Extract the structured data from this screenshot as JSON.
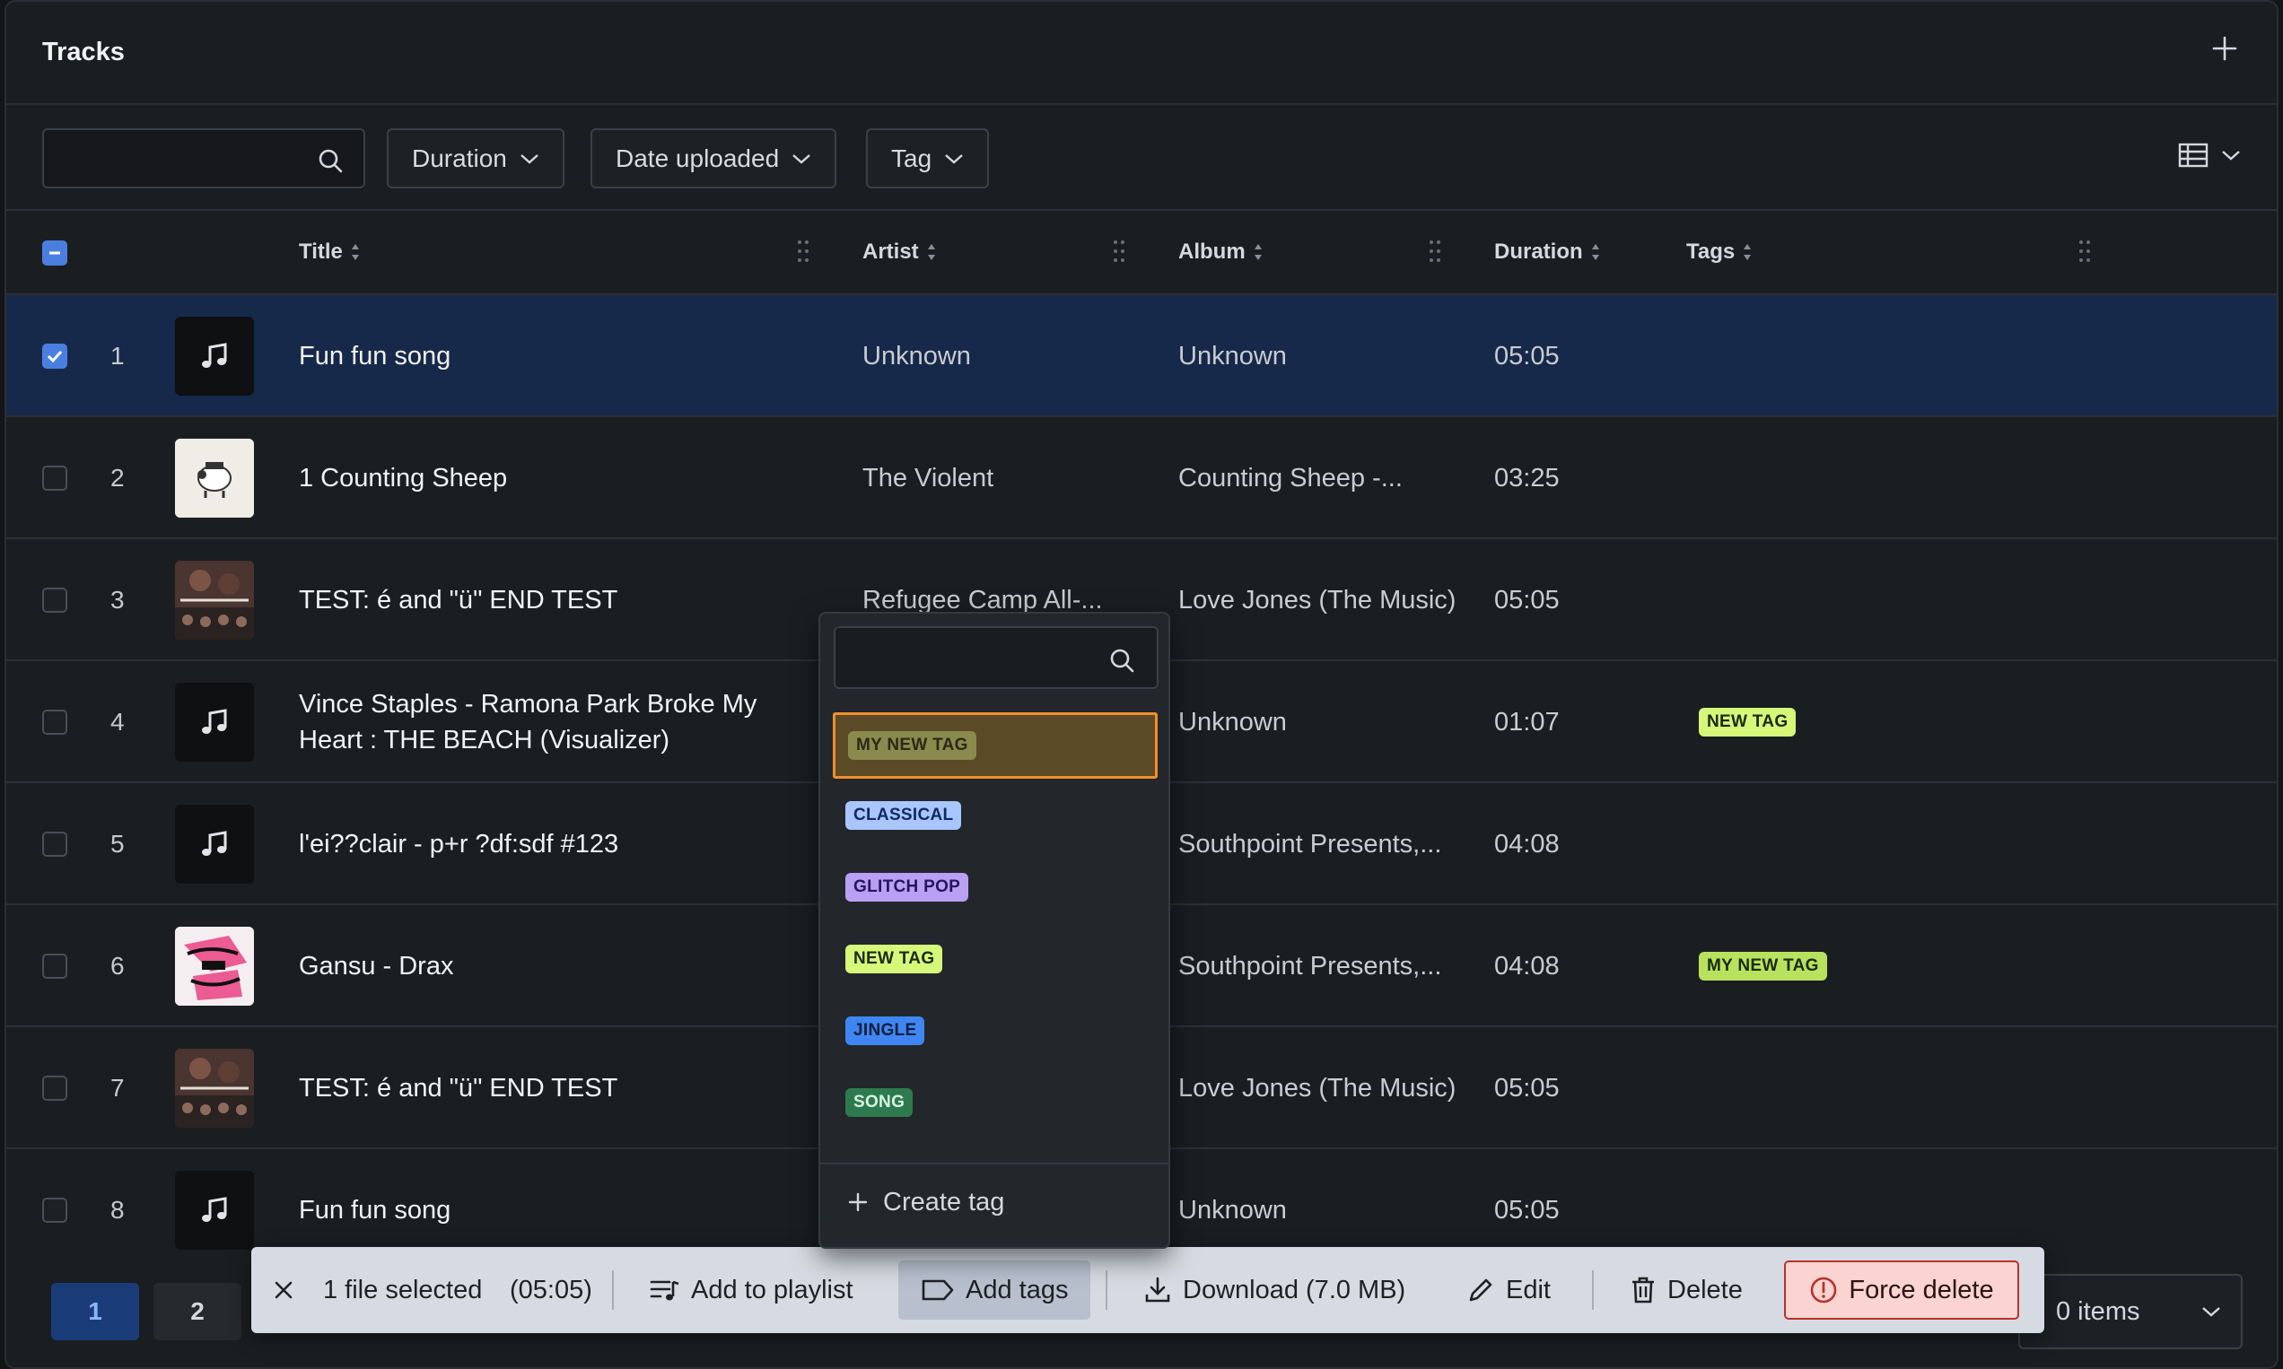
{
  "header": {
    "title": "Tracks"
  },
  "toolbar": {
    "search": {
      "placeholder": "",
      "value": ""
    },
    "filters": [
      {
        "label": "Duration"
      },
      {
        "label": "Date uploaded"
      },
      {
        "label": "Tag"
      }
    ]
  },
  "columns": [
    "Title",
    "Artist",
    "Album",
    "Duration",
    "Tags"
  ],
  "rows": [
    {
      "num": "1",
      "title": "Fun fun song",
      "artist": "Unknown",
      "album": "Unknown",
      "duration": "05:05",
      "tag": "",
      "selected": true,
      "thumb": "music-note"
    },
    {
      "num": "2",
      "title": "1 Counting Sheep",
      "artist": "The Violent",
      "album": "Counting Sheep -...",
      "duration": "03:25",
      "tag": "",
      "selected": false,
      "thumb": "art-sheep"
    },
    {
      "num": "3",
      "title": "TEST: é and \"ü\" END TEST",
      "artist": "Refugee Camp All-...",
      "album": "Love Jones (The Music)",
      "duration": "05:05",
      "tag": "",
      "selected": false,
      "thumb": "art-jones"
    },
    {
      "num": "4",
      "title": "Vince Staples - Ramona Park Broke My Heart : THE BEACH (Visualizer)",
      "artist": "",
      "album": "Unknown",
      "duration": "01:07",
      "tag": "NEW TAG",
      "selected": false,
      "thumb": "music-note"
    },
    {
      "num": "5",
      "title": "l'ei??clair - p+r ?df:sdf #123",
      "artist": "",
      "album": "Southpoint Presents,...",
      "duration": "04:08",
      "tag": "",
      "selected": false,
      "thumb": "music-note"
    },
    {
      "num": "6",
      "title": "Gansu - Drax",
      "artist": "",
      "album": "Southpoint Presents,...",
      "duration": "04:08",
      "tag": "MY NEW TAG",
      "selected": false,
      "thumb": "art-vol6"
    },
    {
      "num": "7",
      "title": "TEST: é and \"ü\" END TEST",
      "artist": "",
      "album": "Love Jones (The Music)",
      "duration": "05:05",
      "tag": "",
      "selected": false,
      "thumb": "art-jones"
    },
    {
      "num": "8",
      "title": "Fun fun song",
      "artist": "",
      "album": "Unknown",
      "duration": "05:05",
      "tag": "",
      "selected": false,
      "thumb": "music-note"
    }
  ],
  "pagination": {
    "pages": [
      "1",
      "2"
    ],
    "items_label": "0 items"
  },
  "action_bar": {
    "selected_label": "1 file selected",
    "selected_duration": "(05:05)",
    "add_to_playlist": "Add to playlist",
    "add_tags": "Add tags",
    "download": "Download (7.0 MB)",
    "edit": "Edit",
    "delete": "Delete",
    "force_delete": "Force delete"
  },
  "tag_dropdown": {
    "search_value": "",
    "options": [
      {
        "label": "MY NEW TAG",
        "bg": "#d5f77a",
        "fg": "#1a2a05"
      },
      {
        "label": "CLASSICAL",
        "bg": "#a9c6ff",
        "fg": "#0f2a66"
      },
      {
        "label": "GLITCH POP",
        "bg": "#b9a0f2",
        "fg": "#2a1360"
      },
      {
        "label": "NEW TAG",
        "bg": "#d5f77a",
        "fg": "#1a2a05"
      },
      {
        "label": "JINGLE",
        "bg": "#3f86f2",
        "fg": "#0b1d3d"
      },
      {
        "label": "SONG",
        "bg": "#2e7a4f",
        "fg": "#d8f5e3"
      }
    ],
    "create_label": "Create tag"
  },
  "colors": {
    "accent": "#4a7fe0",
    "selected_row": "#17294a",
    "focus_outline": "#f0902a",
    "danger": "#b7332c"
  }
}
